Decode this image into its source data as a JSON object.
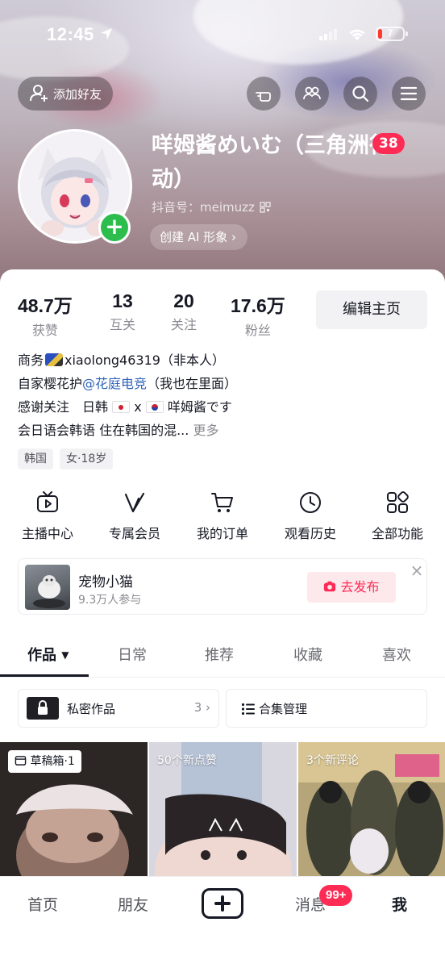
{
  "status_bar": {
    "time": "12:45",
    "battery": "7"
  },
  "header": {
    "add_friend_label": "添加好友",
    "name": "咩姆酱めいむ（三角洲行动）",
    "level_badge": "38",
    "douyin_id": "抖音号：meimuzz",
    "ai_button": "创建 AI 形象 ›"
  },
  "stats": [
    {
      "value": "48.7万",
      "label": "获赞"
    },
    {
      "value": "13",
      "label": "互关"
    },
    {
      "value": "20",
      "label": "关注"
    },
    {
      "value": "17.6万",
      "label": "粉丝"
    }
  ],
  "edit_button": "编辑主页",
  "bio": {
    "line1_prefix": "商务",
    "line1_rest": "xiaolong46319（非本人）",
    "line2_prefix": "自家樱花护",
    "line2_mention": "@花庭电竞",
    "line2_rest": "（我也在里面）",
    "line3_a": "感谢关注　日韩",
    "line3_b": "x",
    "line3_c": "咩姆酱です",
    "line4": "会日语会韩语 住在韩国的混...",
    "more": "更多"
  },
  "tags": [
    "韩国",
    "女·18岁"
  ],
  "services": [
    {
      "label": "主播中心",
      "icon": "tv-icon"
    },
    {
      "label": "专属会员",
      "icon": "vip-icon"
    },
    {
      "label": "我的订单",
      "icon": "cart-icon"
    },
    {
      "label": "观看历史",
      "icon": "clock-icon"
    },
    {
      "label": "全部功能",
      "icon": "grid-icon"
    }
  ],
  "promo": {
    "title": "宠物小猫",
    "subtitle": "9.3万人参与",
    "button": "去发布",
    "close": "×"
  },
  "tabs": [
    "作品",
    "日常",
    "推荐",
    "收藏",
    "喜欢"
  ],
  "tab_arrow": "▼",
  "private_works": {
    "label": "私密作品",
    "count": "3 ›"
  },
  "collection": {
    "label": "合集管理"
  },
  "grid": [
    {
      "tag": "草稿箱·1"
    },
    {
      "tag": "50个新点赞"
    },
    {
      "tag": "3个新评论"
    }
  ],
  "bottom_nav": {
    "home": "首页",
    "friends": "朋友",
    "messages": "消息",
    "messages_badge": "99+",
    "me": "我"
  },
  "colors": {
    "accent": "#fe2c55",
    "link": "#2e63b8",
    "green": "#2dbd4d"
  }
}
